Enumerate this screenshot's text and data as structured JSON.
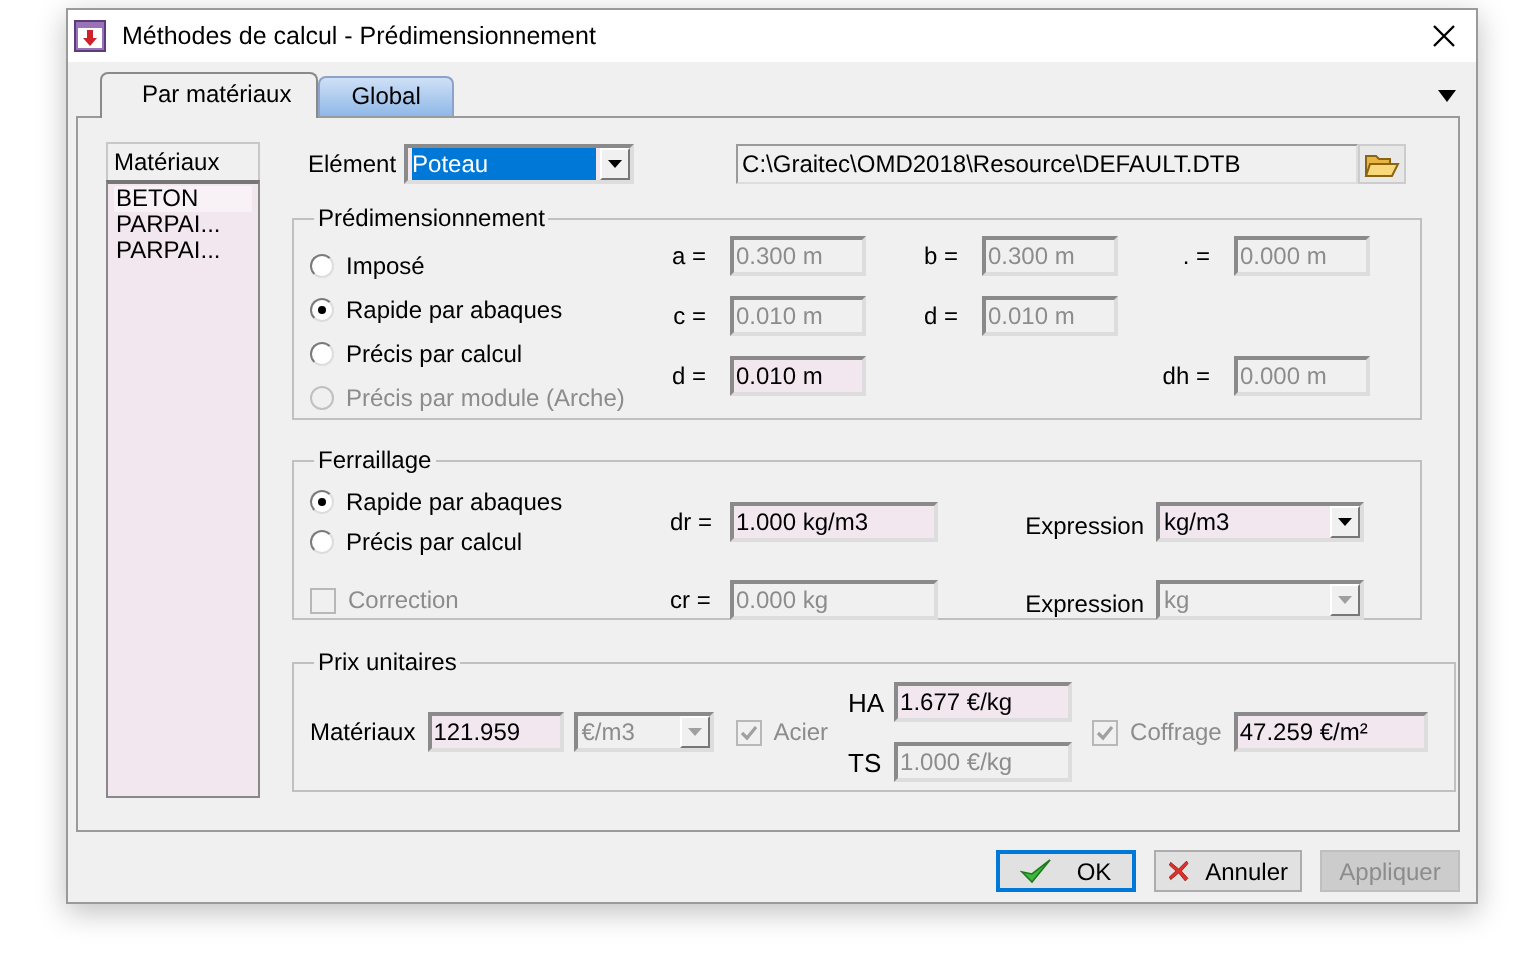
{
  "window": {
    "title": "Méthodes de calcul - Prédimensionnement"
  },
  "tabs": [
    {
      "label": "Par matériaux",
      "selected": true
    },
    {
      "label": "Global",
      "selected": false
    }
  ],
  "materials": {
    "header": "Matériaux",
    "items": [
      {
        "label": "BETON",
        "selected": true
      },
      {
        "label": "PARPAI...",
        "selected": false
      },
      {
        "label": "PARPAI...",
        "selected": false
      }
    ]
  },
  "element": {
    "label": "Elément",
    "value": "Poteau"
  },
  "file_path": "C:\\Graitec\\OMD2018\\Resource\\DEFAULT.DTB",
  "predimensionnement": {
    "title": "Prédimensionnement",
    "options": [
      {
        "label": "Imposé",
        "selected": false,
        "disabled": false
      },
      {
        "label": "Rapide par abaques",
        "selected": true,
        "disabled": false
      },
      {
        "label": "Précis par calcul",
        "selected": false,
        "disabled": false
      },
      {
        "label": "Précis par module (Arche)",
        "selected": false,
        "disabled": true
      }
    ],
    "field_rows": [
      [
        {
          "label": "a =",
          "value": "0.300 m",
          "disabled": true
        },
        {
          "label": "b =",
          "value": "0.300 m",
          "disabled": true
        },
        {
          "label": ". =",
          "value": "0.000 m",
          "disabled": true
        }
      ],
      [
        {
          "label": "c =",
          "value": "0.010 m",
          "disabled": true
        },
        {
          "label": "d =",
          "value": "0.010 m",
          "disabled": true
        },
        null
      ],
      [
        {
          "label": "d =",
          "value": "0.010 m",
          "disabled": false
        },
        null,
        {
          "label": "dh =",
          "value": "0.000 m",
          "disabled": true
        }
      ]
    ]
  },
  "ferraillage": {
    "title": "Ferraillage",
    "options": [
      {
        "label": "Rapide par abaques",
        "selected": true
      },
      {
        "label": "Précis par calcul",
        "selected": false
      }
    ],
    "correction": {
      "label": "Correction",
      "checked": false,
      "disabled": true
    },
    "rows": [
      {
        "label": "dr =",
        "value": "1.000 kg/m3",
        "disabled": false,
        "expression_label": "Expression",
        "expression": "kg/m3",
        "expression_disabled": false
      },
      {
        "label": "cr =",
        "value": "0.000 kg",
        "disabled": true,
        "expression_label": "Expression",
        "expression": "kg",
        "expression_disabled": true
      }
    ]
  },
  "prix": {
    "title": "Prix unitaires",
    "materiaux_label": "Matériaux",
    "materiaux_value": "121.959",
    "materiaux_disabled": false,
    "unit": "€/m3",
    "unit_disabled": true,
    "acier": {
      "label": "Acier",
      "checked": true,
      "disabled": true
    },
    "steel": [
      {
        "label": "HA",
        "value": "1.677 €/kg",
        "disabled": false
      },
      {
        "label": "TS",
        "value": "1.000 €/kg",
        "disabled": true
      }
    ],
    "coffrage": {
      "label": "Coffrage",
      "checked": true,
      "disabled": true
    },
    "coffrage_value": "47.259 €/m²",
    "coffrage_disabled": false
  },
  "buttons": [
    {
      "kind": "ok",
      "label": "OK",
      "default": true,
      "disabled": false
    },
    {
      "kind": "cancel",
      "label": "Annuler",
      "default": false,
      "disabled": false
    },
    {
      "kind": "apply",
      "label": "Appliquer",
      "default": false,
      "disabled": true
    }
  ]
}
